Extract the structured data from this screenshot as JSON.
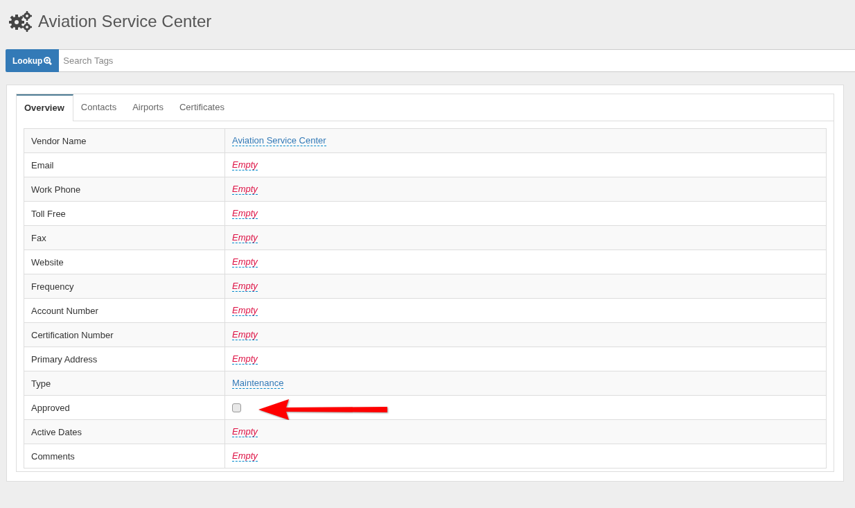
{
  "page": {
    "title": "Aviation Service Center"
  },
  "search": {
    "button": "Lookup",
    "placeholder": "Search Tags"
  },
  "tabs": [
    {
      "label": "Overview",
      "selected": true
    },
    {
      "label": "Contacts",
      "selected": false
    },
    {
      "label": "Airports",
      "selected": false
    },
    {
      "label": "Certificates",
      "selected": false
    }
  ],
  "fields": [
    {
      "label": "Vendor Name",
      "kind": "link",
      "value": "Aviation Service Center"
    },
    {
      "label": "Email",
      "kind": "empty",
      "value": "Empty"
    },
    {
      "label": "Work Phone",
      "kind": "empty",
      "value": "Empty"
    },
    {
      "label": "Toll Free",
      "kind": "empty",
      "value": "Empty"
    },
    {
      "label": "Fax",
      "kind": "empty",
      "value": "Empty"
    },
    {
      "label": "Website",
      "kind": "empty",
      "value": "Empty"
    },
    {
      "label": "Frequency",
      "kind": "empty",
      "value": "Empty"
    },
    {
      "label": "Account Number",
      "kind": "empty",
      "value": "Empty"
    },
    {
      "label": "Certification Number",
      "kind": "empty",
      "value": "Empty"
    },
    {
      "label": "Primary Address",
      "kind": "empty",
      "value": "Empty"
    },
    {
      "label": "Type",
      "kind": "link",
      "value": "Maintenance"
    },
    {
      "label": "Approved",
      "kind": "checkbox",
      "checked": false
    },
    {
      "label": "Active Dates",
      "kind": "empty",
      "value": "Empty"
    },
    {
      "label": "Comments",
      "kind": "empty",
      "value": "Empty"
    }
  ]
}
